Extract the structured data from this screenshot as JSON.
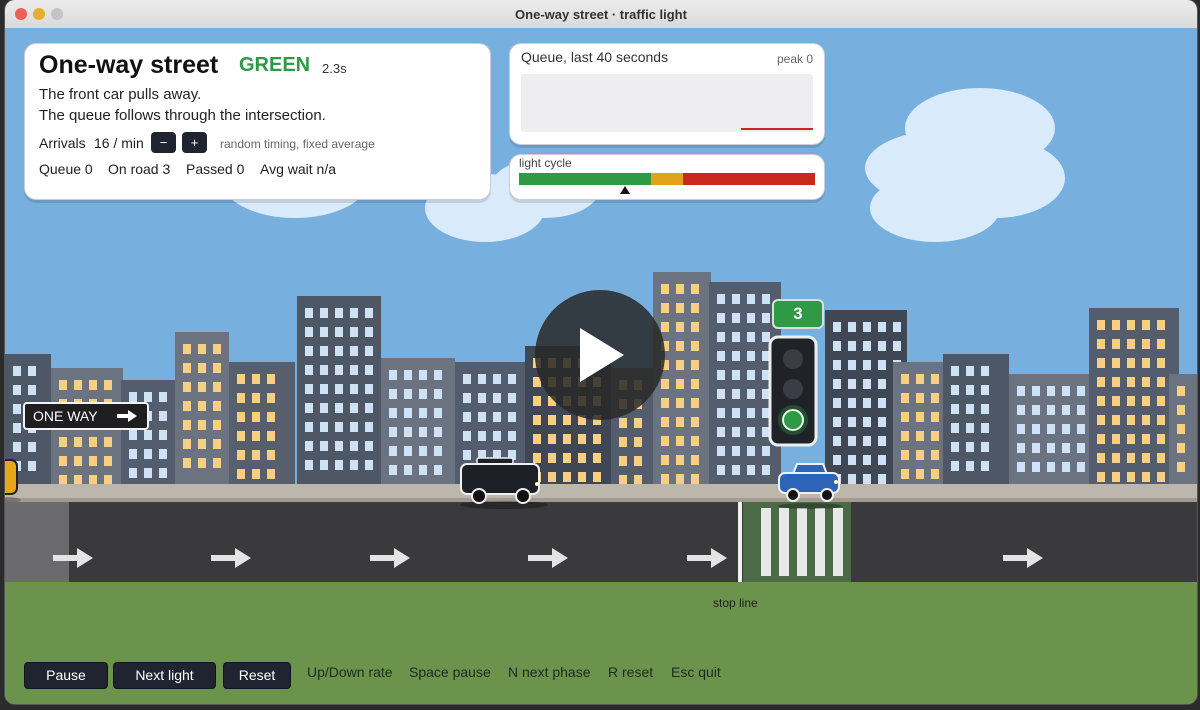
{
  "window": {
    "title": "One-way street · traffic light"
  },
  "info": {
    "heading": "One-way street",
    "state": "GREEN",
    "state_time": "2.3s",
    "line1": "The front car pulls away.",
    "line2": "The queue follows through the intersection.",
    "arrivals_label": "Arrivals",
    "arrivals_value": "16 / min",
    "minus_label": "−",
    "plus_label": "+",
    "arrivals_note": "random timing, fixed average",
    "stats": {
      "queue": "Queue 0",
      "on_road": "On road 3",
      "passed": "Passed 0",
      "avg_wait": "Avg wait n/a"
    }
  },
  "queue_chart": {
    "title": "Queue, last 40 seconds",
    "peak": "peak 0"
  },
  "cycle": {
    "label": "light cycle"
  },
  "scene": {
    "one_way_sign": "ONE WAY",
    "countdown": "3",
    "stop_line_label": "stop line"
  },
  "controls": {
    "pause": "Pause",
    "next_light": "Next light",
    "reset": "Reset"
  },
  "hints": [
    "Up/Down rate",
    "Space pause",
    "N next phase",
    "R reset",
    "Esc quit"
  ],
  "colors": {
    "green": "#2e9a45",
    "amber": "#e3a21c",
    "red": "#c8281e",
    "sky": "#77b0de",
    "grass": "#6c934c",
    "road": "#3a3a3d"
  }
}
